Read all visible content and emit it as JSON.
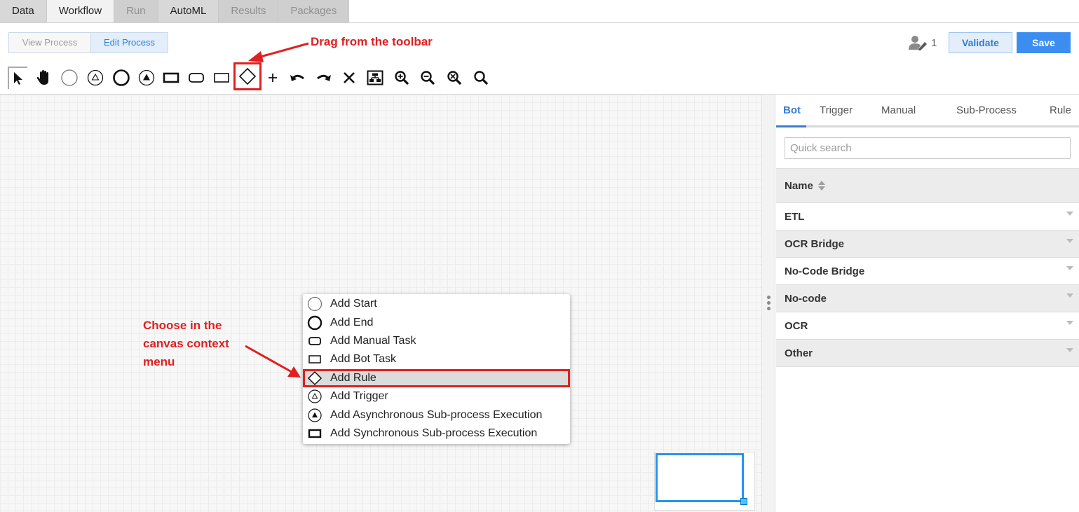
{
  "top_tabs": [
    {
      "label": "Data",
      "state": "normal"
    },
    {
      "label": "Workflow",
      "state": "active"
    },
    {
      "label": "Run",
      "state": "disabled"
    },
    {
      "label": "AutoML",
      "state": "normal"
    },
    {
      "label": "Results",
      "state": "disabled"
    },
    {
      "label": "Packages",
      "state": "disabled"
    }
  ],
  "mode_toggle": {
    "view_label": "View Process",
    "edit_label": "Edit Process",
    "selected": "Edit Process"
  },
  "header": {
    "users_count": "1",
    "validate_label": "Validate",
    "save_label": "Save"
  },
  "toolbar": {
    "tools": [
      "pointer-icon",
      "hand-pan-icon",
      "start-event-icon",
      "trigger-event-icon",
      "end-event-icon",
      "async-subprocess-icon",
      "sync-subprocess-icon",
      "manual-task-icon",
      "bot-task-icon",
      "rule-gateway-icon",
      "add-icon",
      "undo-icon",
      "redo-icon",
      "delete-icon",
      "auto-layout-icon",
      "zoom-in-icon",
      "zoom-out-icon",
      "zoom-fit-icon",
      "zoom-reset-icon"
    ],
    "highlighted_tool": "rule-gateway-icon"
  },
  "annotations": {
    "toolbar_note": "Drag from the toolbar",
    "menu_note_lines": [
      "Choose in the",
      "canvas context",
      "menu"
    ],
    "color": "#e02020"
  },
  "context_menu": {
    "items": [
      {
        "label": "Add Start",
        "icon": "start-event-icon"
      },
      {
        "label": "Add End",
        "icon": "end-event-icon"
      },
      {
        "label": "Add Manual Task",
        "icon": "manual-task-icon"
      },
      {
        "label": "Add Bot Task",
        "icon": "bot-task-icon"
      },
      {
        "label": "Add Rule",
        "icon": "rule-gateway-icon",
        "highlighted": true
      },
      {
        "label": "Add Trigger",
        "icon": "trigger-event-icon"
      },
      {
        "label": "Add Asynchronous Sub-process Execution",
        "icon": "async-subprocess-icon"
      },
      {
        "label": "Add Synchronous Sub-process Execution",
        "icon": "sync-subprocess-icon"
      }
    ]
  },
  "panel": {
    "tabs": [
      "Bot",
      "Trigger",
      "Manual",
      "Sub-Process",
      "Rule"
    ],
    "active_tab": "Bot",
    "search_placeholder": "Quick search",
    "column_header": "Name",
    "rows": [
      "ETL",
      "OCR Bridge",
      "No-Code Bridge",
      "No-code",
      "OCR",
      "Other"
    ]
  },
  "colors": {
    "accent": "#3b7ed0",
    "save_button": "#3b8ef0",
    "annotation_red": "#e02020",
    "minimap_border": "#2196f3"
  }
}
